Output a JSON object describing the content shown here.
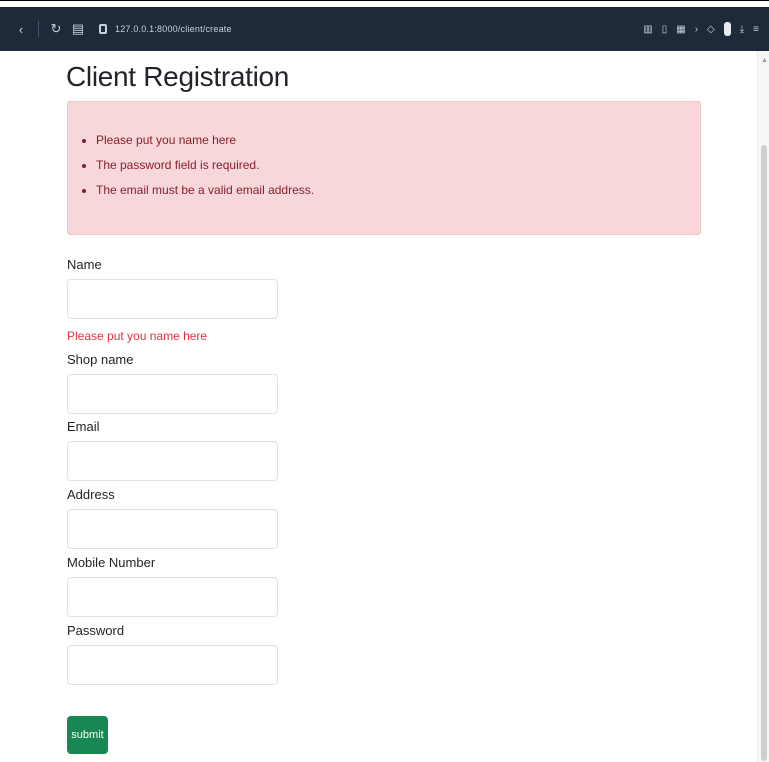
{
  "browser": {
    "url": "127.0.0.1:8000/client/create",
    "back_icon": "back-arrow-icon",
    "reload_icon": "reload-icon",
    "tabs_icon": "tabs-icon",
    "security_icon": "lock-icon"
  },
  "page": {
    "title": "Client Registration",
    "alert_items": [
      "Please put you name here",
      "The password field is required.",
      "The email must be a valid email address."
    ]
  },
  "form": {
    "name_label": "Name",
    "name_value": "",
    "name_error": "Please put you name here",
    "shop_label": "Shop name",
    "shop_value": "",
    "email_label": "Email",
    "email_value": "",
    "address_label": "Address",
    "address_value": "",
    "mobile_label": "Mobile Number",
    "mobile_value": "",
    "password_label": "Password",
    "password_value": "",
    "submit_label": "submit"
  },
  "colors": {
    "alert_bg": "#f8d7da",
    "alert_text": "#842029",
    "error_text": "#dc3545",
    "submit_bg": "#198754",
    "toolbar_bg": "#1e2a3a"
  }
}
